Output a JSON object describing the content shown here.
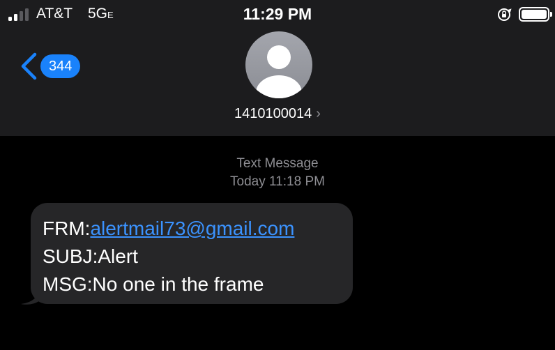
{
  "status_bar": {
    "carrier": "AT&T",
    "network": "5G",
    "network_suffix": "E",
    "time": "11:29 PM",
    "signal_bars_filled": 2,
    "signal_bars_total": 4,
    "battery_level": 1.0
  },
  "nav": {
    "back_badge": "344",
    "contact_number": "1410100014",
    "contact_arrow": "›"
  },
  "thread": {
    "message_type": "Text Message",
    "timestamp": "Today 11:18 PM"
  },
  "message": {
    "from_label": "FRM:",
    "from_email": "alertmail73@gmail.com",
    "subject_line": "SUBJ:Alert",
    "body_line": "MSG:No one in the frame"
  },
  "colors": {
    "header_bg": "#1c1c1e",
    "accent_blue": "#1a82fb",
    "link_blue": "#3b93ff",
    "bubble_bg": "#262628"
  }
}
